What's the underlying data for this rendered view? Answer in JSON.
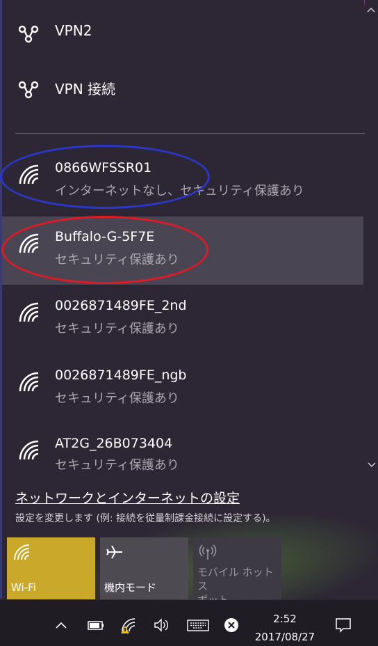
{
  "vpns": [
    {
      "label": "VPN2"
    },
    {
      "label": "VPN 接続"
    }
  ],
  "networks": [
    {
      "name": "0866WFSSR01",
      "status": "インターネットなし、セキュリティ保護あり"
    },
    {
      "name": "Buffalo-G-5F7E",
      "status": "セキュリティ保護あり"
    },
    {
      "name": "0026871489FE_2nd",
      "status": "セキュリティ保護あり"
    },
    {
      "name": "0026871489FE_ngb",
      "status": "セキュリティ保護あり"
    },
    {
      "name": "AT2G_26B073404",
      "status": "セキュリティ保護あり"
    }
  ],
  "settings": {
    "link": "ネットワークとインターネットの設定",
    "description": "設定を変更します (例: 接続を従量制課金接続に設定する)。"
  },
  "tiles": [
    {
      "label": "Wi-Fi",
      "icon": "wifi-icon",
      "state": "on"
    },
    {
      "label": "機内モード",
      "icon": "airplane-icon",
      "state": "off"
    },
    {
      "label": "モバイル ホットス\nポット",
      "icon": "hotspot-icon",
      "state": "disabled"
    }
  ],
  "taskbar": {
    "time": "2:52",
    "date": "2017/08/27"
  },
  "colors": {
    "accent": "#c9a82a",
    "annotation_blue": "#2b37c9",
    "annotation_red": "#e01a25"
  }
}
